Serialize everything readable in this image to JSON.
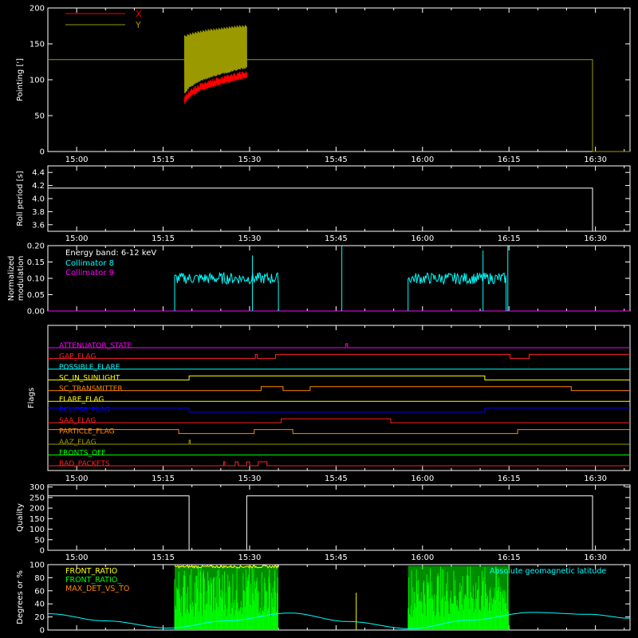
{
  "colors": {
    "background": "#000000",
    "axis": "#ffffff",
    "x": "#ff0000",
    "y": "#9a9a00",
    "collimator8": "#00ffff",
    "collimator9": "#ff00ff",
    "front_ratio": "#ffff00",
    "front_ratio_green": "#00ff00",
    "max_det": "#ff8800",
    "geomag": "#00ffff"
  },
  "time_axis": {
    "ticks": [
      "15:00",
      "15:15",
      "15:30",
      "15:45",
      "16:00",
      "16:15",
      "16:30"
    ],
    "tick_minutes": [
      900,
      915,
      930,
      945,
      960,
      975,
      990
    ],
    "range_minutes": [
      895,
      996
    ]
  },
  "chart_data": [
    {
      "id": "pointing",
      "type": "line",
      "ylabel": "Pointing [']",
      "ylim": [
        0,
        200
      ],
      "yticks": [
        "0",
        "50",
        "100",
        "150",
        "200"
      ],
      "yticks_values": [
        0,
        50,
        100,
        150,
        200
      ],
      "legend": [
        {
          "name": "X",
          "color": "#ff0000"
        },
        {
          "name": "Y",
          "color": "#9a9a00"
        }
      ],
      "series": [
        {
          "name": "X",
          "x": [
            918.7,
            919.5,
            921,
            923,
            925,
            927,
            929.5
          ],
          "y": [
            72,
            80,
            88,
            94,
            99,
            103,
            108
          ]
        },
        {
          "name": "Y",
          "x": [
            918.7,
            919.5,
            921,
            923,
            925,
            927,
            929.5
          ],
          "y": [
            162,
            165,
            168,
            171,
            173,
            175,
            177
          ]
        },
        {
          "name": "baseline",
          "x": [
            895,
            989.5,
            989.5,
            996
          ],
          "y": [
            128,
            128,
            0,
            0
          ]
        }
      ]
    },
    {
      "id": "roll",
      "type": "line",
      "ylabel": "Roll period [s]",
      "ylim": [
        3.5,
        4.5
      ],
      "yticks": [
        "3.6",
        "3.8",
        "4.0",
        "4.2",
        "4.4"
      ],
      "yticks_values": [
        3.6,
        3.8,
        4.0,
        4.2,
        4.4
      ],
      "series": [
        {
          "name": "roll period",
          "x": [
            895,
            989.5,
            989.5
          ],
          "y": [
            4.16,
            4.16,
            3.5
          ]
        }
      ]
    },
    {
      "id": "modulation",
      "type": "line",
      "ylabel": "Normalized modulation",
      "ylim": [
        0,
        0.2
      ],
      "yticks": [
        "0.00",
        "0.05",
        "0.10",
        "0.15",
        "0.20"
      ],
      "yticks_values": [
        0,
        0.05,
        0.1,
        0.15,
        0.2
      ],
      "annotation": "Energy band: 6-12 keV",
      "legend": [
        {
          "name": "Collimator 8",
          "color": "#00ffff"
        },
        {
          "name": "Collimator 9",
          "color": "#ff00ff"
        }
      ],
      "series": [
        {
          "name": "Collimator 8",
          "segments": [
            [
              917,
              935
            ],
            [
              957.5,
              974.5
            ]
          ],
          "level": 0.1,
          "spikes": [
            [
              930.5,
              0.17
            ],
            [
              946,
              0.2
            ],
            [
              970.5,
              0.185
            ],
            [
              974.8,
              0.2
            ]
          ]
        },
        {
          "name": "Collimator 9",
          "level": 0
        }
      ]
    },
    {
      "id": "flags",
      "type": "line",
      "ylabel": "Flags",
      "flags": [
        {
          "name": "ATTENUATOR_STATE",
          "color": "#ff00ff",
          "steps": [
            [
              895,
              0
            ],
            [
              946.7,
              1
            ],
            [
              947,
              0
            ]
          ]
        },
        {
          "name": "GAP_FLAG",
          "color": "#ff2020",
          "steps": [
            [
              895,
              0
            ],
            [
              931,
              1
            ],
            [
              931.3,
              0
            ],
            [
              934.5,
              1
            ],
            [
              975.2,
              0
            ],
            [
              978.5,
              1
            ]
          ]
        },
        {
          "name": "POSSIBLE_FLARE",
          "color": "#00ffff",
          "steps": [
            [
              895,
              0
            ]
          ]
        },
        {
          "name": "SC_IN_SUNLIGHT",
          "color": "#ffff00",
          "steps": [
            [
              895,
              0
            ],
            [
              919.5,
              1
            ],
            [
              970.8,
              0
            ]
          ]
        },
        {
          "name": "SC_TRANSMITTER",
          "color": "#ff8800",
          "steps": [
            [
              895,
              0
            ],
            [
              932,
              1
            ],
            [
              935.8,
              0
            ],
            [
              940.5,
              1
            ],
            [
              985.8,
              0
            ]
          ]
        },
        {
          "name": "FLARE_FLAG",
          "color": "#ffff00",
          "steps": [
            [
              895,
              0
            ]
          ]
        },
        {
          "name": "ECLIPSE_FLAG",
          "color": "#0000ff",
          "steps": [
            [
              895,
              1
            ],
            [
              919.5,
              0
            ],
            [
              970.8,
              1
            ]
          ]
        },
        {
          "name": "SAA_FLAG",
          "color": "#ff2020",
          "steps": [
            [
              895,
              0
            ],
            [
              935.5,
              1
            ],
            [
              954.5,
              0
            ]
          ]
        },
        {
          "name": "PARTICLE_FLAG",
          "color": "#ff8800",
          "steps": [
            [
              895,
              1
            ],
            [
              917.7,
              0
            ],
            [
              930.8,
              1
            ],
            [
              937.5,
              0
            ],
            [
              976.5,
              1
            ]
          ]
        },
        {
          "name": "AAZ_FLAG",
          "color": "#9a9a00",
          "steps": [
            [
              895,
              0
            ],
            [
              919.5,
              1
            ],
            [
              919.7,
              0
            ]
          ]
        },
        {
          "name": "FRONTS_OFF",
          "color": "#00ff00",
          "steps": [
            [
              895,
              0
            ]
          ]
        },
        {
          "name": "BAD_PACKETS",
          "color": "#ff2020",
          "steps": [
            [
              895,
              0
            ],
            [
              925.5,
              1
            ],
            [
              925.7,
              0
            ],
            [
              927.5,
              1
            ],
            [
              928,
              0
            ],
            [
              929.5,
              1
            ],
            [
              930,
              0
            ],
            [
              931.5,
              1
            ],
            [
              933,
              0
            ]
          ]
        }
      ]
    },
    {
      "id": "quality",
      "type": "line",
      "ylabel": "Quality",
      "ylim": [
        0,
        310
      ],
      "yticks": [
        "0",
        "50",
        "100",
        "150",
        "200",
        "250",
        "300"
      ],
      "yticks_values": [
        0,
        50,
        100,
        150,
        200,
        250,
        300
      ],
      "series": [
        {
          "name": "quality",
          "x": [
            895,
            919.5,
            919.5,
            929.5,
            929.5,
            989.5,
            989.5,
            996
          ],
          "y": [
            258,
            258,
            0,
            0,
            258,
            258,
            0,
            0
          ]
        }
      ]
    },
    {
      "id": "ratios",
      "type": "line",
      "ylabel": "Degrees or %",
      "ylim": [
        0,
        100
      ],
      "yticks": [
        "0",
        "20",
        "40",
        "60",
        "80",
        "100"
      ],
      "yticks_values": [
        0,
        20,
        40,
        60,
        80,
        100
      ],
      "legend": [
        {
          "name": "FRONT_RATIO",
          "color": "#ffff00"
        },
        {
          "name": "FRONT_RATIO_",
          "color": "#00ff00"
        },
        {
          "name": "MAX_DET_VS_TO",
          "color": "#ff8800"
        }
      ],
      "annotation": "Absolute geomagnetic latitude",
      "series": [
        {
          "name": "FRONT_RATIO band",
          "segments": [
            [
              917,
              935
            ],
            [
              957.5,
              975
            ]
          ],
          "level": 97
        },
        {
          "name": "Absolute geomagnetic latitude",
          "x": [
            895,
            905,
            916,
            926,
            937,
            947,
            958,
            968,
            979,
            989,
            996
          ],
          "y": [
            25,
            14,
            3,
            14,
            26,
            13,
            2,
            15,
            27,
            24,
            18
          ]
        }
      ]
    }
  ]
}
